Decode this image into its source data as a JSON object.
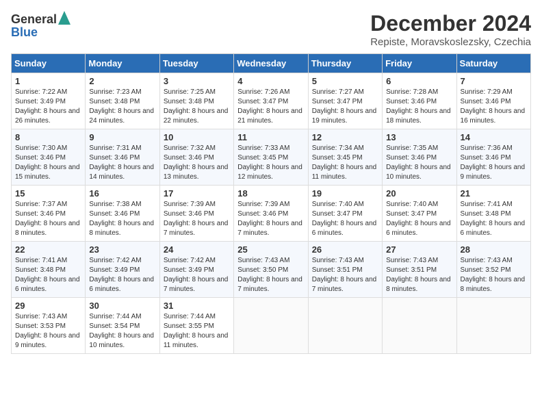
{
  "logo": {
    "general": "General",
    "blue": "Blue"
  },
  "title": "December 2024",
  "subtitle": "Repiste, Moravskoslezsky, Czechia",
  "headers": [
    "Sunday",
    "Monday",
    "Tuesday",
    "Wednesday",
    "Thursday",
    "Friday",
    "Saturday"
  ],
  "weeks": [
    [
      {
        "day": "1",
        "sunrise": "7:22 AM",
        "sunset": "3:49 PM",
        "daylight": "8 hours and 26 minutes."
      },
      {
        "day": "2",
        "sunrise": "7:23 AM",
        "sunset": "3:48 PM",
        "daylight": "8 hours and 24 minutes."
      },
      {
        "day": "3",
        "sunrise": "7:25 AM",
        "sunset": "3:48 PM",
        "daylight": "8 hours and 22 minutes."
      },
      {
        "day": "4",
        "sunrise": "7:26 AM",
        "sunset": "3:47 PM",
        "daylight": "8 hours and 21 minutes."
      },
      {
        "day": "5",
        "sunrise": "7:27 AM",
        "sunset": "3:47 PM",
        "daylight": "8 hours and 19 minutes."
      },
      {
        "day": "6",
        "sunrise": "7:28 AM",
        "sunset": "3:46 PM",
        "daylight": "8 hours and 18 minutes."
      },
      {
        "day": "7",
        "sunrise": "7:29 AM",
        "sunset": "3:46 PM",
        "daylight": "8 hours and 16 minutes."
      }
    ],
    [
      {
        "day": "8",
        "sunrise": "7:30 AM",
        "sunset": "3:46 PM",
        "daylight": "8 hours and 15 minutes."
      },
      {
        "day": "9",
        "sunrise": "7:31 AM",
        "sunset": "3:46 PM",
        "daylight": "8 hours and 14 minutes."
      },
      {
        "day": "10",
        "sunrise": "7:32 AM",
        "sunset": "3:46 PM",
        "daylight": "8 hours and 13 minutes."
      },
      {
        "day": "11",
        "sunrise": "7:33 AM",
        "sunset": "3:45 PM",
        "daylight": "8 hours and 12 minutes."
      },
      {
        "day": "12",
        "sunrise": "7:34 AM",
        "sunset": "3:45 PM",
        "daylight": "8 hours and 11 minutes."
      },
      {
        "day": "13",
        "sunrise": "7:35 AM",
        "sunset": "3:46 PM",
        "daylight": "8 hours and 10 minutes."
      },
      {
        "day": "14",
        "sunrise": "7:36 AM",
        "sunset": "3:46 PM",
        "daylight": "8 hours and 9 minutes."
      }
    ],
    [
      {
        "day": "15",
        "sunrise": "7:37 AM",
        "sunset": "3:46 PM",
        "daylight": "8 hours and 8 minutes."
      },
      {
        "day": "16",
        "sunrise": "7:38 AM",
        "sunset": "3:46 PM",
        "daylight": "8 hours and 8 minutes."
      },
      {
        "day": "17",
        "sunrise": "7:39 AM",
        "sunset": "3:46 PM",
        "daylight": "8 hours and 7 minutes."
      },
      {
        "day": "18",
        "sunrise": "7:39 AM",
        "sunset": "3:46 PM",
        "daylight": "8 hours and 7 minutes."
      },
      {
        "day": "19",
        "sunrise": "7:40 AM",
        "sunset": "3:47 PM",
        "daylight": "8 hours and 6 minutes."
      },
      {
        "day": "20",
        "sunrise": "7:40 AM",
        "sunset": "3:47 PM",
        "daylight": "8 hours and 6 minutes."
      },
      {
        "day": "21",
        "sunrise": "7:41 AM",
        "sunset": "3:48 PM",
        "daylight": "8 hours and 6 minutes."
      }
    ],
    [
      {
        "day": "22",
        "sunrise": "7:41 AM",
        "sunset": "3:48 PM",
        "daylight": "8 hours and 6 minutes."
      },
      {
        "day": "23",
        "sunrise": "7:42 AM",
        "sunset": "3:49 PM",
        "daylight": "8 hours and 6 minutes."
      },
      {
        "day": "24",
        "sunrise": "7:42 AM",
        "sunset": "3:49 PM",
        "daylight": "8 hours and 7 minutes."
      },
      {
        "day": "25",
        "sunrise": "7:43 AM",
        "sunset": "3:50 PM",
        "daylight": "8 hours and 7 minutes."
      },
      {
        "day": "26",
        "sunrise": "7:43 AM",
        "sunset": "3:51 PM",
        "daylight": "8 hours and 7 minutes."
      },
      {
        "day": "27",
        "sunrise": "7:43 AM",
        "sunset": "3:51 PM",
        "daylight": "8 hours and 8 minutes."
      },
      {
        "day": "28",
        "sunrise": "7:43 AM",
        "sunset": "3:52 PM",
        "daylight": "8 hours and 8 minutes."
      }
    ],
    [
      {
        "day": "29",
        "sunrise": "7:43 AM",
        "sunset": "3:53 PM",
        "daylight": "8 hours and 9 minutes."
      },
      {
        "day": "30",
        "sunrise": "7:44 AM",
        "sunset": "3:54 PM",
        "daylight": "8 hours and 10 minutes."
      },
      {
        "day": "31",
        "sunrise": "7:44 AM",
        "sunset": "3:55 PM",
        "daylight": "8 hours and 11 minutes."
      },
      null,
      null,
      null,
      null
    ]
  ]
}
